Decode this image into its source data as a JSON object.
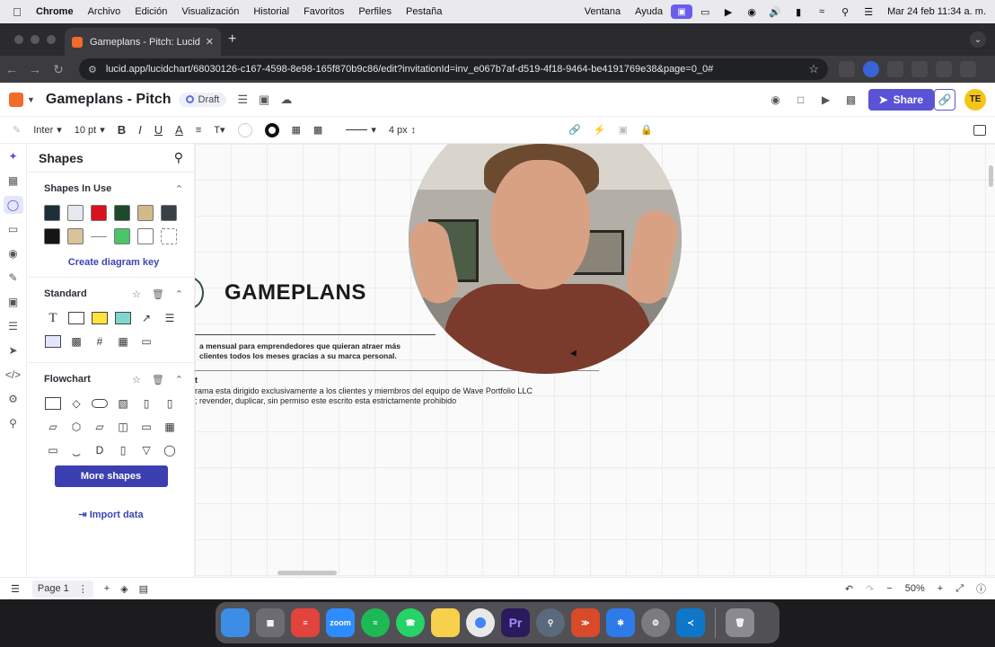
{
  "menubar": {
    "items": [
      "Chrome",
      "Archivo",
      "Edición",
      "Visualización",
      "Historial",
      "Favoritos",
      "Perfiles",
      "Pestaña"
    ],
    "right_items": [
      "Ventana",
      "Ayuda"
    ],
    "clock": "Mar 24 feb  11:34 a. m."
  },
  "browser": {
    "tab_title": "Gameplans - Pitch: Lucidchar",
    "url": "lucid.app/lucidchart/68030126-c167-4598-8e98-165f870b9c86/edit?invitationId=inv_e067b7af-d519-4f18-9464-be4191769e38&page=0_0#"
  },
  "header": {
    "doc_title": "Gameplans - Pitch",
    "badge": "Draft",
    "share_label": "Share",
    "avatar_initials": "TE"
  },
  "toolbar": {
    "font": "Inter",
    "font_size": "10 pt",
    "line_width": "4 px"
  },
  "panel": {
    "title": "Shapes",
    "shapes_in_use": "Shapes In Use",
    "swatches": [
      "#1e2f38",
      "#e6e8f0",
      "#d9121f",
      "#1c4a2a",
      "#d2b98a",
      "#3a4048",
      "#151515",
      "#d8c39a",
      "#cfcfcf",
      "#4cc56a",
      "#ffffff",
      "#ffffff"
    ],
    "create_key": "Create diagram key",
    "standard": "Standard",
    "flowchart": "Flowchart",
    "more_shapes": "More shapes",
    "import_data": "Import data"
  },
  "canvas": {
    "title": "GAMEPLANS",
    "subtitle_line1": "a mensual para emprendedores que quieran atraer más",
    "subtitle_line2": "clientes todos los meses gracias a su marca personal.",
    "note_title": "t",
    "note_line1": "rama esta dirigido exclusivamente a los clientes y miembros del equipo de Wave Portfolio LLC",
    "note_line2": "; revender, duplicar, sin permiso este escrito esta estrictamente prohibido"
  },
  "bottom": {
    "page_label": "Page 1",
    "zoom": "50%"
  },
  "dock": {
    "apps": [
      "Finder",
      "Launchpad",
      "Todoist",
      "zoom",
      "Spotify",
      "WhatsApp",
      "Notes",
      "Chrome",
      "Pr",
      "QuickTime",
      "Bitrix",
      "Asana",
      "Settings",
      "VS Code",
      "Trash"
    ]
  }
}
